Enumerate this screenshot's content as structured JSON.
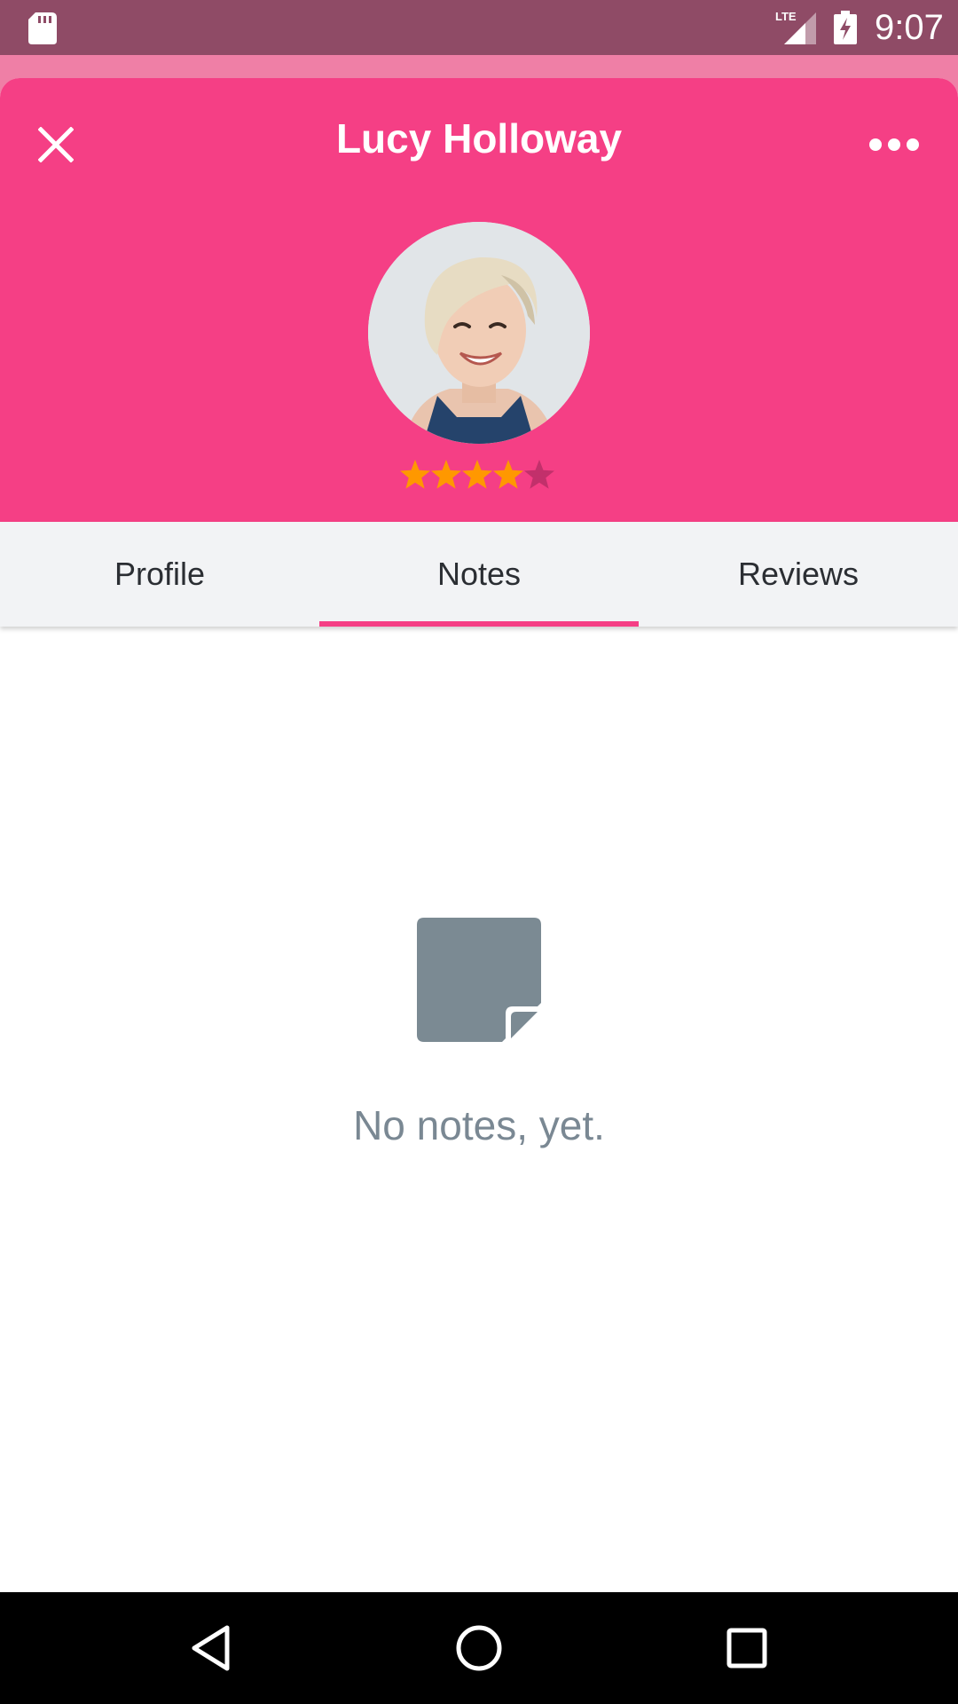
{
  "status_bar": {
    "time": "9:07",
    "network_label": "LTE",
    "icons": [
      "sd-card-icon",
      "lte-signal-icon",
      "battery-charging-icon"
    ]
  },
  "header": {
    "title": "Lucy Holloway",
    "icons": [
      "close-icon",
      "more-horizontal-icon"
    ],
    "background_color": "#f53f85",
    "rating": {
      "value": 4,
      "max": 5,
      "filled_color": "#ff9800",
      "empty_color": "#c2306b"
    }
  },
  "tabs": {
    "items": [
      {
        "label": "Profile"
      },
      {
        "label": "Notes"
      },
      {
        "label": "Reviews"
      }
    ],
    "selected": "Notes",
    "indicator_color": "#f53f85"
  },
  "empty_state": {
    "icon": "note-icon",
    "message": "No notes, yet.",
    "color": "#7a8893"
  },
  "nav_bar": {
    "icons": [
      "back-triangle-icon",
      "home-circle-icon",
      "recents-square-icon"
    ]
  }
}
